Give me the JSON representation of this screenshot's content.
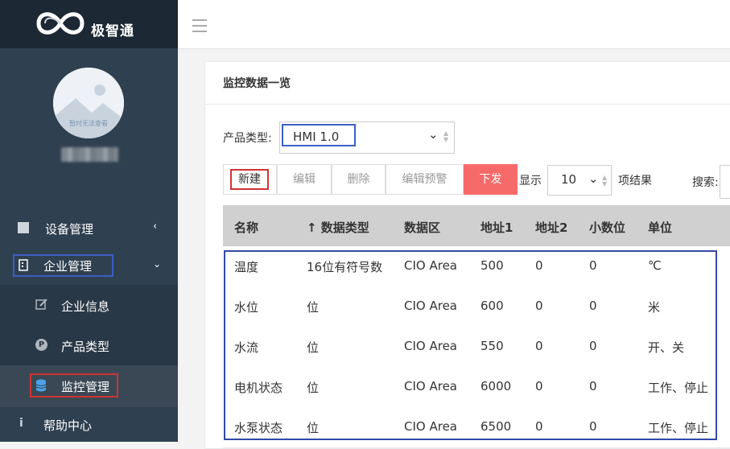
{
  "app": {
    "brand": "极智通"
  },
  "sidebar": {
    "avatar_caption": "暂时无法查看",
    "items": [
      {
        "label": "设备管理",
        "icon": "square-icon"
      },
      {
        "label": "企业管理",
        "icon": "building-icon"
      },
      {
        "label": "企业信息",
        "icon": "edit-icon"
      },
      {
        "label": "产品类型",
        "icon": "parking-icon"
      },
      {
        "label": "监控管理",
        "icon": "database-icon"
      },
      {
        "label": "帮助中心",
        "icon": "info-icon"
      }
    ]
  },
  "panel": {
    "title": "监控数据一览"
  },
  "filter": {
    "label": "产品类型:",
    "value": "HMI 1.0"
  },
  "toolbar": {
    "new_label": "新建",
    "edit_label": "编辑",
    "delete_label": "删除",
    "alert_label": "编辑预警",
    "push_label": "下发",
    "show_label": "显示",
    "page_size": "10",
    "items_label": "项结果",
    "search_label": "搜索:"
  },
  "table": {
    "headers": [
      "名称",
      "↑ 数据类型",
      "数据区",
      "地址1",
      "地址2",
      "小数位",
      "单位"
    ],
    "rows": [
      [
        "温度",
        "16位有符号数",
        "CIO Area",
        "500",
        "0",
        "0",
        "℃"
      ],
      [
        "水位",
        "位",
        "CIO Area",
        "600",
        "0",
        "0",
        "米"
      ],
      [
        "水流",
        "位",
        "CIO Area",
        "550",
        "0",
        "0",
        "开、关"
      ],
      [
        "电机状态",
        "位",
        "CIO Area",
        "6000",
        "0",
        "0",
        "工作、停止"
      ],
      [
        "水泵状态",
        "位",
        "CIO Area",
        "6500",
        "0",
        "0",
        "工作、停止"
      ]
    ]
  },
  "colors": {
    "sidebar": "#2f4050",
    "logo_bar": "#1c2833",
    "accent_red": "#f76a6a",
    "highlight_blue": "#3b5fc4",
    "highlight_red": "#d03333"
  }
}
